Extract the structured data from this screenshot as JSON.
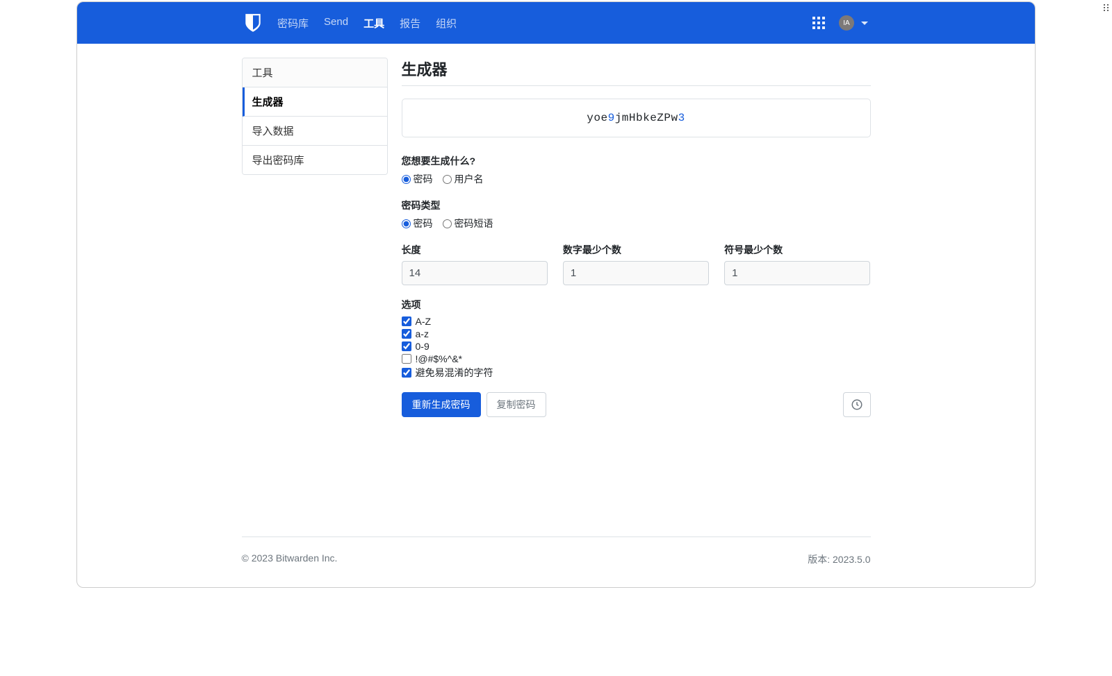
{
  "nav": {
    "vault": "密码库",
    "send": "Send",
    "tools": "工具",
    "reports": "报告",
    "orgs": "组织"
  },
  "avatar_initials": "IA",
  "sidebar": {
    "header": "工具",
    "items": [
      "生成器",
      "导入数据",
      "导出密码库"
    ]
  },
  "page_title": "生成器",
  "password": {
    "seg1": "yoe",
    "seg2": "9",
    "seg3": "jmHbkeZPw",
    "seg4": "3"
  },
  "labels": {
    "what_generate": "您想要生成什么?",
    "opt_password": "密码",
    "opt_username": "用户名",
    "password_type": "密码类型",
    "opt_pw": "密码",
    "opt_passphrase": "密码短语",
    "length": "长度",
    "min_digits": "数字最少个数",
    "min_symbols": "符号最少个数",
    "options": "选项",
    "upper": "A-Z",
    "lower": "a-z",
    "digits": "0-9",
    "symbols": "!@#$%^&*",
    "avoid_ambiguous": "避免易混淆的字符"
  },
  "values": {
    "length": "14",
    "min_digits": "1",
    "min_symbols": "1"
  },
  "buttons": {
    "regenerate": "重新生成密码",
    "copy": "复制密码"
  },
  "footer": {
    "copyright": "© 2023 Bitwarden Inc.",
    "version": "版本: 2023.5.0"
  }
}
